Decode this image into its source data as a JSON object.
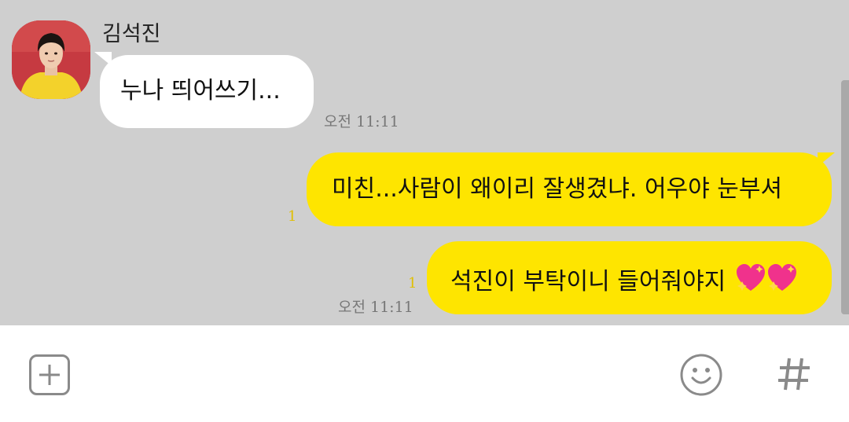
{
  "chat": {
    "sender_name": "김석진",
    "incoming": {
      "text": "누나 띄어쓰기...",
      "time": "오전 11:11"
    },
    "outgoing": [
      {
        "text": "미친...사람이 왜이리 잘생겼냐. 어우야 눈부셔",
        "unread": "1"
      },
      {
        "text": "석진이 부탁이니 들어줘야지",
        "emoji": "sparkling-heart-icon x2",
        "unread": "1",
        "time": "오전 11:11"
      }
    ]
  },
  "input_bar": {
    "add_icon": "plus-square-icon",
    "emoji_icon": "smiley-icon",
    "hash_icon": "hash-icon"
  },
  "colors": {
    "chat_background": "#cfcfcf",
    "outgoing_bubble": "#fee500",
    "incoming_bubble": "#ffffff",
    "unread_count": "#e0bf00"
  }
}
